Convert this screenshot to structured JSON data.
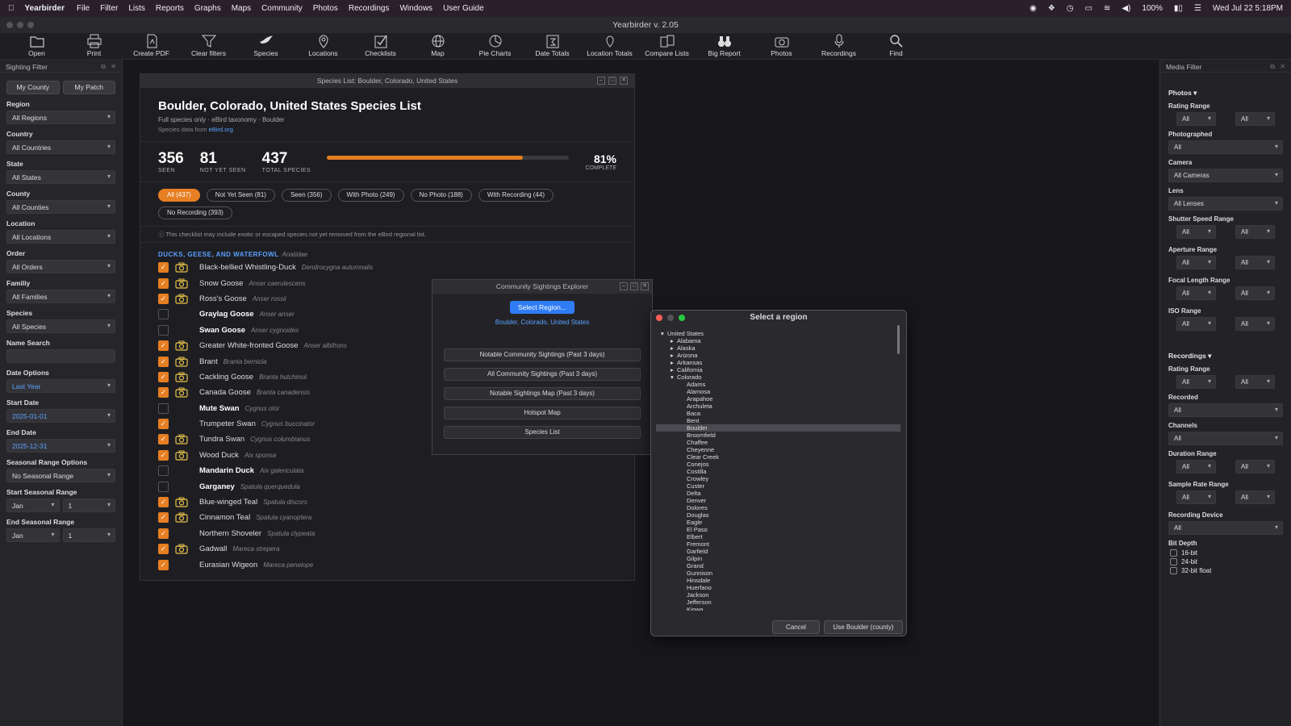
{
  "menubar": {
    "app": "Yearbirder",
    "items": [
      "File",
      "Filter",
      "Lists",
      "Reports",
      "Graphs",
      "Maps",
      "Community",
      "Photos",
      "Recordings",
      "Windows",
      "User Guide"
    ],
    "battery": "100%",
    "datetime": "Wed Jul 22  5:18PM"
  },
  "window": {
    "title": "Yearbirder v. 2.05"
  },
  "toolbar": {
    "items": [
      {
        "label": "Open",
        "icon": "folder-icon"
      },
      {
        "label": "Print",
        "icon": "printer-icon"
      },
      {
        "label": "Create PDF",
        "icon": "pdf-icon"
      },
      {
        "label": "Clear filters",
        "icon": "funnel-icon"
      },
      {
        "label": "Species",
        "icon": "bird-icon"
      },
      {
        "label": "Locations",
        "icon": "map-pin-icon"
      },
      {
        "label": "Checklists",
        "icon": "checklist-icon"
      },
      {
        "label": "Map",
        "icon": "globe-icon"
      },
      {
        "label": "Pie Charts",
        "icon": "pie-chart-icon"
      },
      {
        "label": "Date Totals",
        "icon": "calendar-sum-icon"
      },
      {
        "label": "Location Totals",
        "icon": "location-sum-icon"
      },
      {
        "label": "Compare Lists",
        "icon": "compare-icon"
      },
      {
        "label": "Big Report",
        "icon": "binoculars-icon"
      },
      {
        "label": "Photos",
        "icon": "camera-icon"
      },
      {
        "label": "Recordings",
        "icon": "microphone-icon"
      },
      {
        "label": "Find",
        "icon": "search-icon"
      }
    ]
  },
  "sighting_filter": {
    "title": "Sighting Filter",
    "my_county": "My County",
    "my_patch": "My Patch",
    "region_label": "Region",
    "region": "All Regions",
    "country_label": "Country",
    "country": "All Countries",
    "state_label": "State",
    "state": "All States",
    "county_label": "County",
    "county": "All Counties",
    "location_label": "Location",
    "location": "All Locations",
    "order_label": "Order",
    "order": "All Orders",
    "family_label": "Familiy",
    "family": "All Families",
    "species_label": "Species",
    "species": "All Species",
    "name_search_label": "Name Search",
    "name_search": "",
    "date_options_label": "Date Options",
    "date_options": "Last Year",
    "start_date_label": "Start Date",
    "start_date": "2025-01-01",
    "end_date_label": "End Date",
    "end_date": "2025-12-31",
    "seasonal_options_label": "Seasonal Range Options",
    "seasonal_options": "No Seasonal Range",
    "start_seasonal_label": "Start Seasonal Range",
    "start_seasonal_month": "Jan",
    "start_seasonal_day": "1",
    "end_seasonal_label": "End Seasonal Range",
    "end_seasonal_month": "Jan",
    "end_seasonal_day": "1"
  },
  "species_list": {
    "window_title": "Species List: Boulder, Colorado, United States",
    "title": "Boulder, Colorado, United States Species List",
    "subtitle": "Full species only · eBird taxonomy · Boulder",
    "source_prefix": "Species data from",
    "source_link": "eBird.org",
    "seen": "356",
    "seen_label": "SEEN",
    "not_seen": "81",
    "not_seen_label": "NOT YET SEEN",
    "total": "437",
    "total_label": "TOTAL SPECIES",
    "complete_pct": "81%",
    "complete_label": "COMPLETE",
    "progress": 0.81,
    "accent": "#e67e22",
    "filters": [
      "All (437)",
      "Not Yet Seen (81)",
      "Seen (356)",
      "With Photo (249)",
      "No Photo (188)",
      "With Recording (44)",
      "No Recording (393)"
    ],
    "note": "This checklist may include exotic or escaped species not yet removed from the eBird regional list.",
    "group_name": "DUCKS, GEESE, AND WATERFOWL",
    "group_sci": "Anatidae",
    "rows": [
      {
        "name": "Black-bellied Whistling-Duck",
        "sci": "Dendrocygna autumnalis",
        "seen": true,
        "photo": true
      },
      {
        "name": "Snow Goose",
        "sci": "Anser caerulescens",
        "seen": true,
        "photo": true
      },
      {
        "name": "Ross's Goose",
        "sci": "Anser rossii",
        "seen": true,
        "photo": true
      },
      {
        "name": "Graylag Goose",
        "sci": "Anser anser",
        "seen": false,
        "photo": false
      },
      {
        "name": "Swan Goose",
        "sci": "Anser cygnoides",
        "seen": false,
        "photo": false
      },
      {
        "name": "Greater White-fronted Goose",
        "sci": "Anser albifrons",
        "seen": true,
        "photo": true
      },
      {
        "name": "Brant",
        "sci": "Branta bernicla",
        "seen": true,
        "photo": true
      },
      {
        "name": "Cackling Goose",
        "sci": "Branta hutchinsii",
        "seen": true,
        "photo": true
      },
      {
        "name": "Canada Goose",
        "sci": "Branta canadensis",
        "seen": true,
        "photo": true
      },
      {
        "name": "Mute Swan",
        "sci": "Cygnus olor",
        "seen": false,
        "photo": false
      },
      {
        "name": "Trumpeter Swan",
        "sci": "Cygnus buccinator",
        "seen": true,
        "photo": false
      },
      {
        "name": "Tundra Swan",
        "sci": "Cygnus columbianus",
        "seen": true,
        "photo": true
      },
      {
        "name": "Wood Duck",
        "sci": "Aix sponsa",
        "seen": true,
        "photo": true
      },
      {
        "name": "Mandarin Duck",
        "sci": "Aix galericulata",
        "seen": false,
        "photo": false
      },
      {
        "name": "Garganey",
        "sci": "Spatula querquedula",
        "seen": false,
        "photo": false
      },
      {
        "name": "Blue-winged Teal",
        "sci": "Spatula discors",
        "seen": true,
        "photo": true
      },
      {
        "name": "Cinnamon Teal",
        "sci": "Spatula cyanoptera",
        "seen": true,
        "photo": true
      },
      {
        "name": "Northern Shoveler",
        "sci": "Spatula clypeata",
        "seen": true,
        "photo": false
      },
      {
        "name": "Gadwall",
        "sci": "Mareca strepera",
        "seen": true,
        "photo": true
      },
      {
        "name": "Eurasian Wigeon",
        "sci": "Mareca penelope",
        "seen": true,
        "photo": false
      }
    ]
  },
  "community": {
    "title": "Community Sightings Explorer",
    "select_region": "Select Region...",
    "region": "Boulder, Colorado, United States",
    "buttons": [
      "Notable Community Sightings (Past 3 days)",
      "All Community Sightings (Past 3 days)",
      "Notable Sightings Map (Past 3 days)",
      "Hotspot Map",
      "Species List"
    ]
  },
  "region_dialog": {
    "title": "Select a region",
    "tree": [
      {
        "label": "United States",
        "level": 0,
        "toggle": "open"
      },
      {
        "label": "Alabama",
        "level": 1,
        "toggle": "closed"
      },
      {
        "label": "Alaska",
        "level": 1,
        "toggle": "closed"
      },
      {
        "label": "Arizona",
        "level": 1,
        "toggle": "closed"
      },
      {
        "label": "Arkansas",
        "level": 1,
        "toggle": "closed"
      },
      {
        "label": "California",
        "level": 1,
        "toggle": "closed"
      },
      {
        "label": "Colorado",
        "level": 1,
        "toggle": "open"
      },
      {
        "label": "Adams",
        "level": 2
      },
      {
        "label": "Alamosa",
        "level": 2
      },
      {
        "label": "Arapahoe",
        "level": 2
      },
      {
        "label": "Archuleta",
        "level": 2
      },
      {
        "label": "Baca",
        "level": 2
      },
      {
        "label": "Bent",
        "level": 2
      },
      {
        "label": "Boulder",
        "level": 2,
        "selected": true
      },
      {
        "label": "Broomfield",
        "level": 2
      },
      {
        "label": "Chaffee",
        "level": 2
      },
      {
        "label": "Cheyenne",
        "level": 2
      },
      {
        "label": "Clear Creek",
        "level": 2
      },
      {
        "label": "Conejos",
        "level": 2
      },
      {
        "label": "Costilla",
        "level": 2
      },
      {
        "label": "Crowley",
        "level": 2
      },
      {
        "label": "Custer",
        "level": 2
      },
      {
        "label": "Delta",
        "level": 2
      },
      {
        "label": "Denver",
        "level": 2
      },
      {
        "label": "Dolores",
        "level": 2
      },
      {
        "label": "Douglas",
        "level": 2
      },
      {
        "label": "Eagle",
        "level": 2
      },
      {
        "label": "El Paso",
        "level": 2
      },
      {
        "label": "Elbert",
        "level": 2
      },
      {
        "label": "Fremont",
        "level": 2
      },
      {
        "label": "Garfield",
        "level": 2
      },
      {
        "label": "Gilpin",
        "level": 2
      },
      {
        "label": "Grand",
        "level": 2
      },
      {
        "label": "Gunnison",
        "level": 2
      },
      {
        "label": "Hinsdale",
        "level": 2
      },
      {
        "label": "Huerfano",
        "level": 2
      },
      {
        "label": "Jackson",
        "level": 2
      },
      {
        "label": "Jefferson",
        "level": 2
      },
      {
        "label": "Kiowa",
        "level": 2
      }
    ],
    "cancel": "Cancel",
    "confirm": "Use Boulder (county)"
  },
  "media_filter": {
    "title": "Media Filter",
    "photos_header": "Photos ▾",
    "rating_range_label": "Rating Range",
    "rating_min": "All",
    "rating_max": "All",
    "photographed_label": "Photographed",
    "photographed": "All",
    "camera_label": "Camera",
    "camera": "All Cameras",
    "lens_label": "Lens",
    "lens": "All Lenses",
    "shutter_label": "Shutter Speed Range",
    "shutter_min": "All",
    "shutter_max": "All",
    "aperture_label": "Aperture Range",
    "aperture_min": "All",
    "aperture_max": "All",
    "focal_label": "Focal Length Range",
    "focal_min": "All",
    "focal_max": "All",
    "iso_label": "ISO Range",
    "iso_min": "All",
    "iso_max": "All",
    "recordings_header": "Recordings ▾",
    "rec_rating_label": "Rating Range",
    "rec_rating_min": "All",
    "rec_rating_max": "All",
    "recorded_label": "Recorded",
    "recorded": "All",
    "channels_label": "Channels",
    "channels": "All",
    "duration_label": "Duration Range",
    "duration_min": "All",
    "duration_max": "All",
    "sample_label": "Sample Rate Range",
    "sample_min": "All",
    "sample_max": "All",
    "device_label": "Recording Device",
    "device": "All",
    "bit_depth_label": "Bit Depth",
    "bit_depths": [
      "16-bit",
      "24-bit",
      "32-bit float"
    ]
  }
}
